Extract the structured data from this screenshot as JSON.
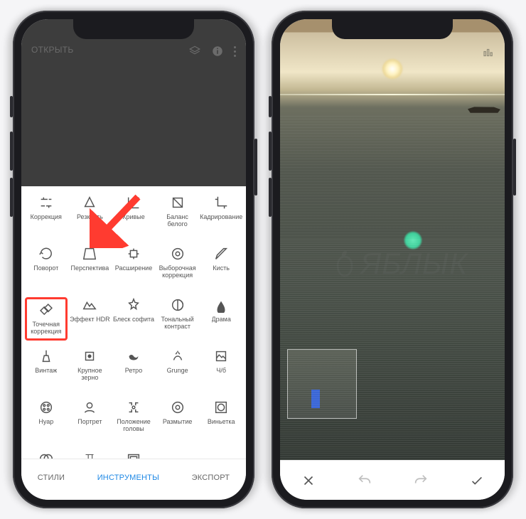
{
  "watermark_text": "ЯБЛЫК",
  "left": {
    "open_label": "ОТКРЫТЬ",
    "highlighted_tool_index": 10,
    "tools": [
      {
        "label": "Коррекция"
      },
      {
        "label": "Резкость"
      },
      {
        "label": "Кривые"
      },
      {
        "label": "Баланс белого"
      },
      {
        "label": "Кадрирование"
      },
      {
        "label": "Поворот"
      },
      {
        "label": "Перспектива"
      },
      {
        "label": "Расширение"
      },
      {
        "label": "Выборочная коррекция"
      },
      {
        "label": "Кисть"
      },
      {
        "label": "Точечная коррекция"
      },
      {
        "label": "Эффект HDR"
      },
      {
        "label": "Блеск софита"
      },
      {
        "label": "Тональный контраст"
      },
      {
        "label": "Драма"
      },
      {
        "label": "Винтаж"
      },
      {
        "label": "Крупное зерно"
      },
      {
        "label": "Ретро"
      },
      {
        "label": "Grunge"
      },
      {
        "label": "Ч/б"
      },
      {
        "label": "Нуар"
      },
      {
        "label": "Портрет"
      },
      {
        "label": "Положение головы"
      },
      {
        "label": "Размытие"
      },
      {
        "label": "Виньетка"
      },
      {
        "label": "Двойная экспозиция"
      },
      {
        "label": "Текст"
      },
      {
        "label": "Рамки"
      }
    ],
    "tabs": {
      "styles": "СТИЛИ",
      "tools": "ИНСТРУМЕНТЫ",
      "export": "ЭКСПОРТ",
      "active": "tools"
    }
  }
}
